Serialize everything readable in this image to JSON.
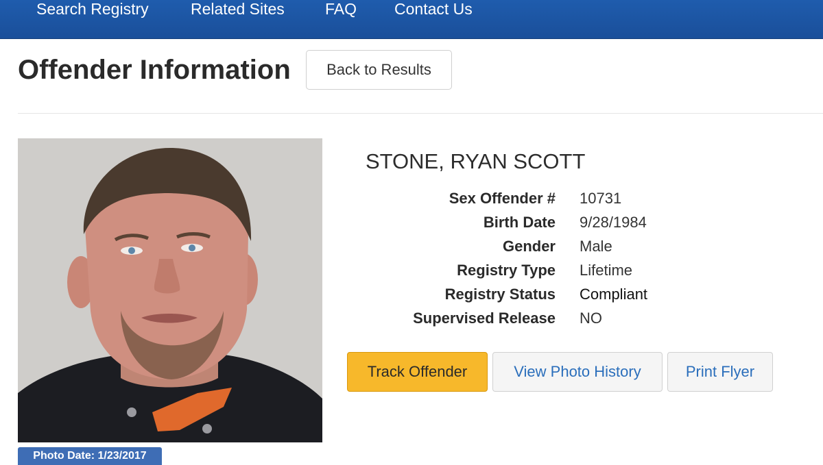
{
  "nav": {
    "items": [
      "Search Registry",
      "Related Sites",
      "FAQ",
      "Contact Us"
    ]
  },
  "page": {
    "title": "Offender Information",
    "back_button": "Back to Results"
  },
  "offender": {
    "name": "STONE, RYAN SCOTT",
    "photo_date": "Photo Date: 1/23/2017",
    "details": [
      {
        "label": "Sex Offender #",
        "value": "10731"
      },
      {
        "label": "Birth Date",
        "value": "9/28/1984"
      },
      {
        "label": "Gender",
        "value": "Male"
      },
      {
        "label": "Registry Type",
        "value": "Lifetime"
      },
      {
        "label": "Registry Status",
        "value": "Compliant"
      },
      {
        "label": "Supervised Release",
        "value": "NO"
      }
    ]
  },
  "actions": {
    "track": "Track Offender",
    "photo_history": "View Photo History",
    "print": "Print Flyer"
  },
  "colors": {
    "nav_bg": "#1f5cad",
    "track_button": "#f7b82b",
    "link_text": "#2a6ebb",
    "badge_bg": "#3e6db5"
  }
}
